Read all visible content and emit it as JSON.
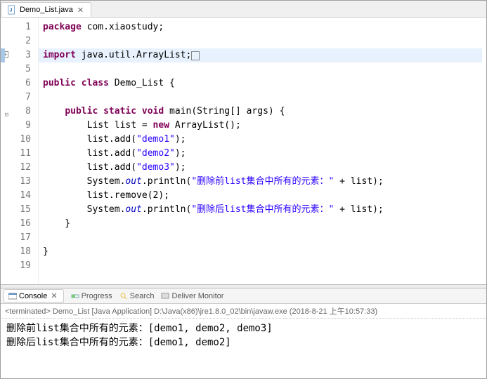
{
  "tab": {
    "filename": "Demo_List.java"
  },
  "code": {
    "lines": [
      {
        "n": 1,
        "html": "<span class='kw'>package</span> com.xiaostudy;"
      },
      {
        "n": 2,
        "html": ""
      },
      {
        "n": 3,
        "html": "<span class='kw'>import</span> java.util.ArrayList;<span class='cbox'>&nbsp;</span>",
        "hl": true,
        "expand": true,
        "marker": true
      },
      {
        "n": 5,
        "html": ""
      },
      {
        "n": 6,
        "html": "<span class='kw'>public class</span> Demo_List {"
      },
      {
        "n": 7,
        "html": ""
      },
      {
        "n": 8,
        "html": "    <span class='kw'>public static void</span> main(String[] args) {",
        "fold": true
      },
      {
        "n": 9,
        "html": "        List list = <span class='kw'>new</span> ArrayList();"
      },
      {
        "n": 10,
        "html": "        list.add(<span class='str'>\"demo1\"</span>);"
      },
      {
        "n": 11,
        "html": "        list.add(<span class='str'>\"demo2\"</span>);"
      },
      {
        "n": 12,
        "html": "        list.add(<span class='str'>\"demo3\"</span>);"
      },
      {
        "n": 13,
        "html": "        System.<span class='fld'>out</span>.println(<span class='str'>\"删除前list集合中所有的元素：\"</span> + list);"
      },
      {
        "n": 14,
        "html": "        list.remove(2);"
      },
      {
        "n": 15,
        "html": "        System.<span class='fld'>out</span>.println(<span class='str'>\"删除后list集合中所有的元素：\"</span> + list);"
      },
      {
        "n": 16,
        "html": "    }"
      },
      {
        "n": 17,
        "html": ""
      },
      {
        "n": 18,
        "html": "}"
      },
      {
        "n": 19,
        "html": ""
      }
    ]
  },
  "console": {
    "tabs": {
      "console": "Console",
      "progress": "Progress",
      "search": "Search",
      "deliver": "Deliver Monitor"
    },
    "terminated": "<terminated> Demo_List [Java Application] D:\\Java(x86)\\jre1.8.0_02\\bin\\javaw.exe (2018-8-21 上午10:57:33)",
    "output": "删除前list集合中所有的元素：[demo1, demo2, demo3]\n删除后list集合中所有的元素：[demo1, demo2]"
  }
}
